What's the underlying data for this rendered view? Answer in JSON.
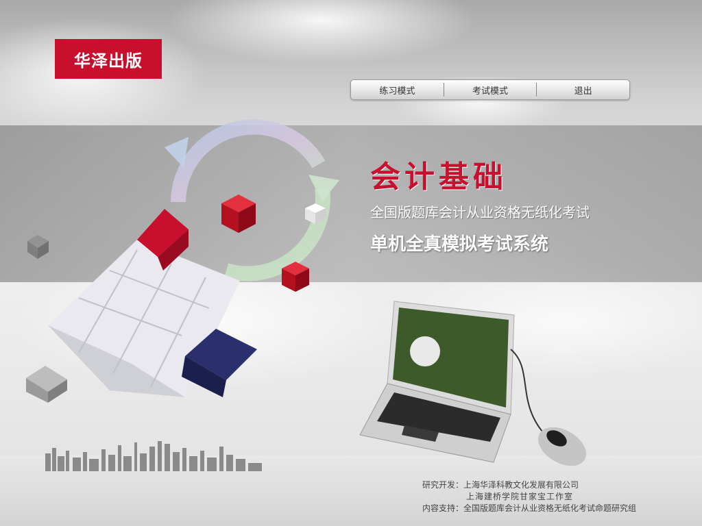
{
  "brand": {
    "logo_text": "华泽出版",
    "brand_color": "#c8102e"
  },
  "nav": {
    "items": [
      {
        "label": "练习模式"
      },
      {
        "label": "考试模式"
      },
      {
        "label": "退出"
      }
    ]
  },
  "hero": {
    "title": "会计基础",
    "subtitle": "全国版题库会计从业资格无纸化考试",
    "subtitle2": "单机全真模拟考试系统"
  },
  "footer": {
    "line1": "研究开发：上海华泽科教文化发展有限公司",
    "line2": "上海建桥学院甘家宝工作室",
    "line3": "内容支持：全国版题库会计从业资格无纸化考试命题研究组"
  },
  "graphics": {
    "cube_icon": "rubiks-cube-icon",
    "arrows_icon": "recycle-arrows-icon",
    "laptop_icon": "laptop-icon",
    "mouse_icon": "mouse-icon",
    "skyline_icon": "city-skyline-icon"
  }
}
